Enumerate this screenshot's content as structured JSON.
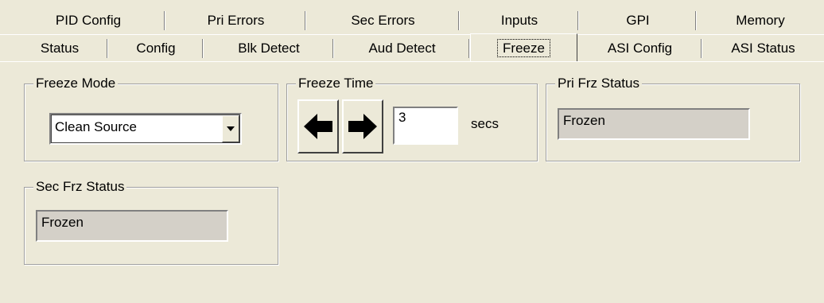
{
  "tabs": {
    "back_row": [
      {
        "label": "PID Config"
      },
      {
        "label": "Pri Errors"
      },
      {
        "label": "Sec Errors"
      },
      {
        "label": "Inputs"
      },
      {
        "label": "GPI"
      },
      {
        "label": "Memory"
      }
    ],
    "front_row": [
      {
        "label": "Status"
      },
      {
        "label": "Config"
      },
      {
        "label": "Blk Detect"
      },
      {
        "label": "Aud Detect"
      },
      {
        "label": "Freeze",
        "active": true
      },
      {
        "label": "ASI Config"
      },
      {
        "label": "ASI Status"
      }
    ]
  },
  "freeze_mode": {
    "legend": "Freeze Mode",
    "selected": "Clean Source"
  },
  "freeze_time": {
    "legend": "Freeze Time",
    "value": "3",
    "unit": "secs",
    "left_icon": "arrow-left-icon",
    "right_icon": "arrow-right-icon"
  },
  "pri_frz_status": {
    "legend": "Pri Frz Status",
    "value": "Frozen"
  },
  "sec_frz_status": {
    "legend": "Sec Frz Status",
    "value": "Frozen"
  }
}
